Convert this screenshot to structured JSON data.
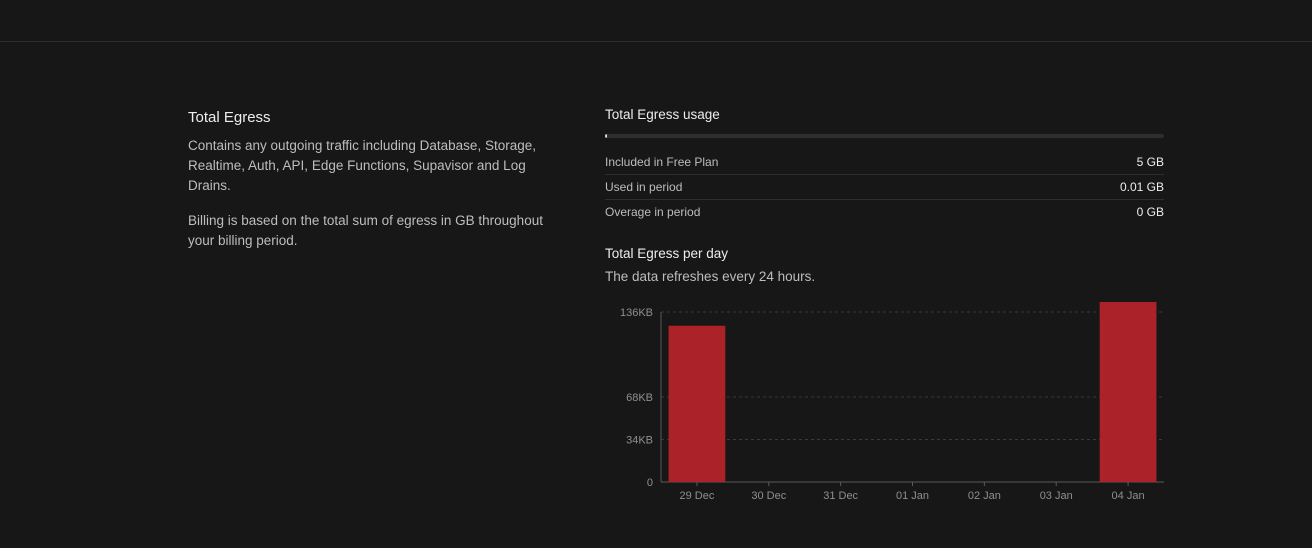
{
  "info": {
    "title": "Total Egress",
    "description": "Contains any outgoing traffic including Database, Storage, Realtime, Auth, API, Edge Functions, Supavisor and Log Drains.",
    "billing_note": "Billing is based on the total sum of egress in GB throughout your billing period."
  },
  "usage": {
    "title": "Total Egress usage",
    "progress_fraction": 0.002,
    "rows": [
      {
        "label": "Included in Free Plan",
        "value": "5 GB"
      },
      {
        "label": "Used in period",
        "value": "0.01 GB"
      },
      {
        "label": "Overage in period",
        "value": "0 GB"
      }
    ]
  },
  "per_day": {
    "title": "Total Egress per day",
    "description": "The data refreshes every 24 hours."
  },
  "colors": {
    "bar": "#ab2229",
    "grid": "#3a3a3a",
    "axis": "#5a5a5a",
    "tick_text": "#8f8f8f"
  },
  "chart_data": {
    "type": "bar",
    "categories": [
      "29 Dec",
      "30 Dec",
      "31 Dec",
      "01 Jan",
      "02 Jan",
      "03 Jan",
      "04 Jan"
    ],
    "values": [
      125,
      0,
      0,
      0,
      0,
      0,
      144
    ],
    "y_unit": "KB",
    "yticks": [
      {
        "value": 0,
        "label": "0"
      },
      {
        "value": 34,
        "label": "34KB"
      },
      {
        "value": 68,
        "label": "68KB"
      },
      {
        "value": 136,
        "label": "136KB"
      }
    ],
    "ylim": [
      0,
      136
    ],
    "grid": true,
    "title": "",
    "xlabel": "",
    "ylabel": ""
  }
}
